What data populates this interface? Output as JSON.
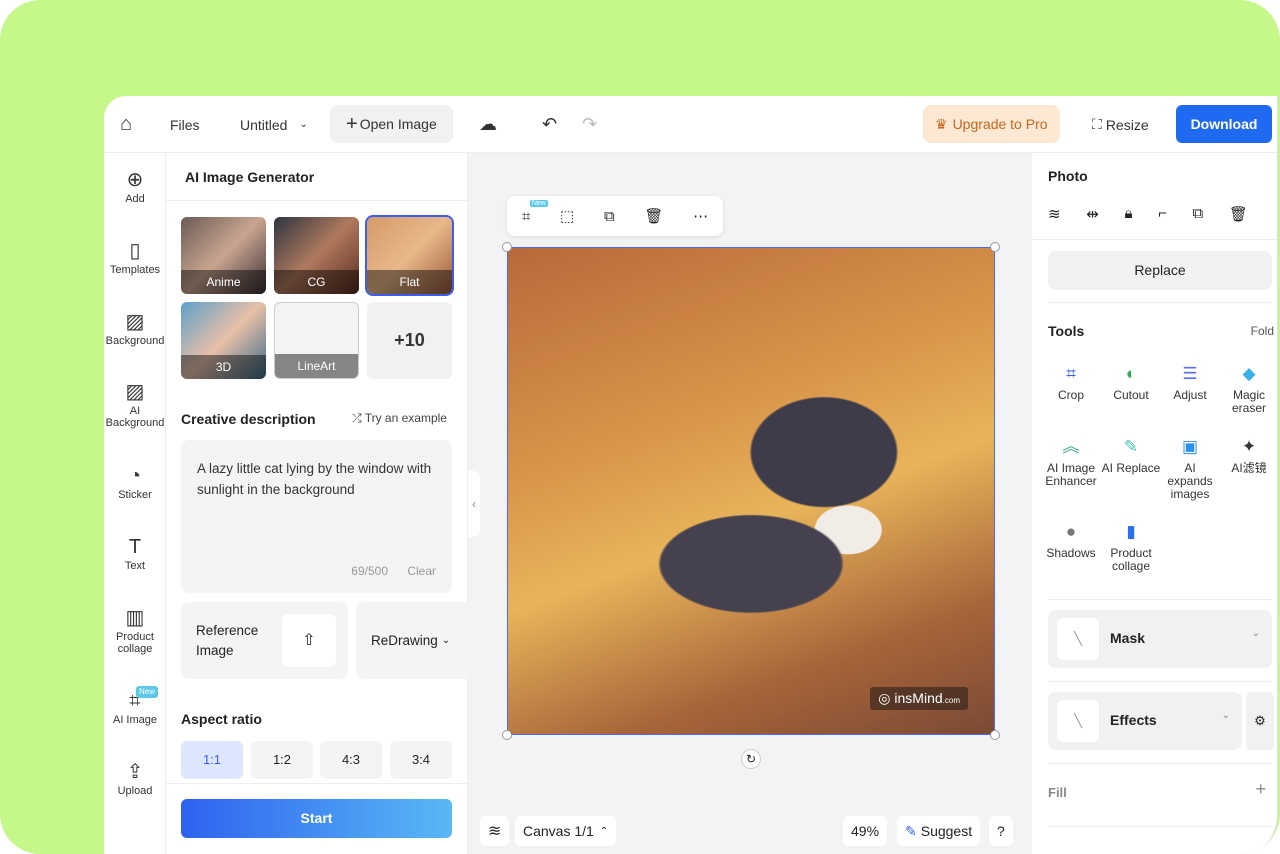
{
  "topbar": {
    "files": "Files",
    "title": "Untitled",
    "open_image": "Open Image",
    "upgrade": "Upgrade to Pro",
    "resize": "Resize",
    "download": "Download"
  },
  "rail": [
    {
      "label": "Add",
      "icon": "⊕"
    },
    {
      "label": "Templates",
      "icon": "▯"
    },
    {
      "label": "Background",
      "icon": "▨"
    },
    {
      "label": "AI Background",
      "icon": "▨"
    },
    {
      "label": "Sticker",
      "icon": "◔"
    },
    {
      "label": "Text",
      "icon": "T"
    },
    {
      "label": "Product collage",
      "icon": "▥"
    },
    {
      "label": "AI Image",
      "icon": "⌗",
      "badge": "New"
    },
    {
      "label": "Upload",
      "icon": "⇪"
    }
  ],
  "left_panel": {
    "title": "AI Image Generator",
    "styles": [
      "Anime",
      "CG",
      "Flat",
      "3D",
      "LineArt"
    ],
    "more_styles": "+10",
    "selected_style": "Flat",
    "description_label": "Creative description",
    "try_example": "Try an example",
    "description": "A lazy little cat lying by the window with sunlight in the background",
    "char_count": "69/500",
    "clear": "Clear",
    "reference_image": "Reference Image",
    "redrawing": "ReDrawing",
    "aspect_label": "Aspect ratio",
    "aspects": [
      "1:1",
      "1:2",
      "4:3",
      "3:4"
    ],
    "selected_aspect": "1:1",
    "start": "Start"
  },
  "canvas": {
    "float_badge": "New",
    "watermark": "insMind",
    "watermark_suffix": ".com",
    "canvas_label": "Canvas 1/1",
    "zoom": "49%",
    "suggest": "Suggest",
    "help": "?"
  },
  "right_panel": {
    "section": "Photo",
    "replace": "Replace",
    "tools_label": "Tools",
    "fold": "Fold",
    "tools": [
      {
        "label": "Crop",
        "icon": "⌗",
        "color": "#3d5cf0"
      },
      {
        "label": "Cutout",
        "icon": "◐",
        "color": "#2fae5a"
      },
      {
        "label": "Adjust",
        "icon": "☰",
        "color": "#5a6cf0"
      },
      {
        "label": "Magic eraser",
        "icon": "◆",
        "color": "#3ab0e8"
      },
      {
        "label": "AI Image Enhancer",
        "icon": "︽",
        "color": "#2fae7a"
      },
      {
        "label": "AI Replace",
        "icon": "✎",
        "color": "#4bc4b0"
      },
      {
        "label": "AI expands images",
        "icon": "▣",
        "color": "#2a8ff0"
      },
      {
        "label": "AI滤镜",
        "icon": "✦",
        "color": "#333"
      },
      {
        "label": "Shadows",
        "icon": "●",
        "color": "#777"
      },
      {
        "label": "Product collage",
        "icon": "▮",
        "color": "#2a6ff0"
      }
    ],
    "mask": "Mask",
    "effects": "Effects",
    "fill": "Fill"
  }
}
